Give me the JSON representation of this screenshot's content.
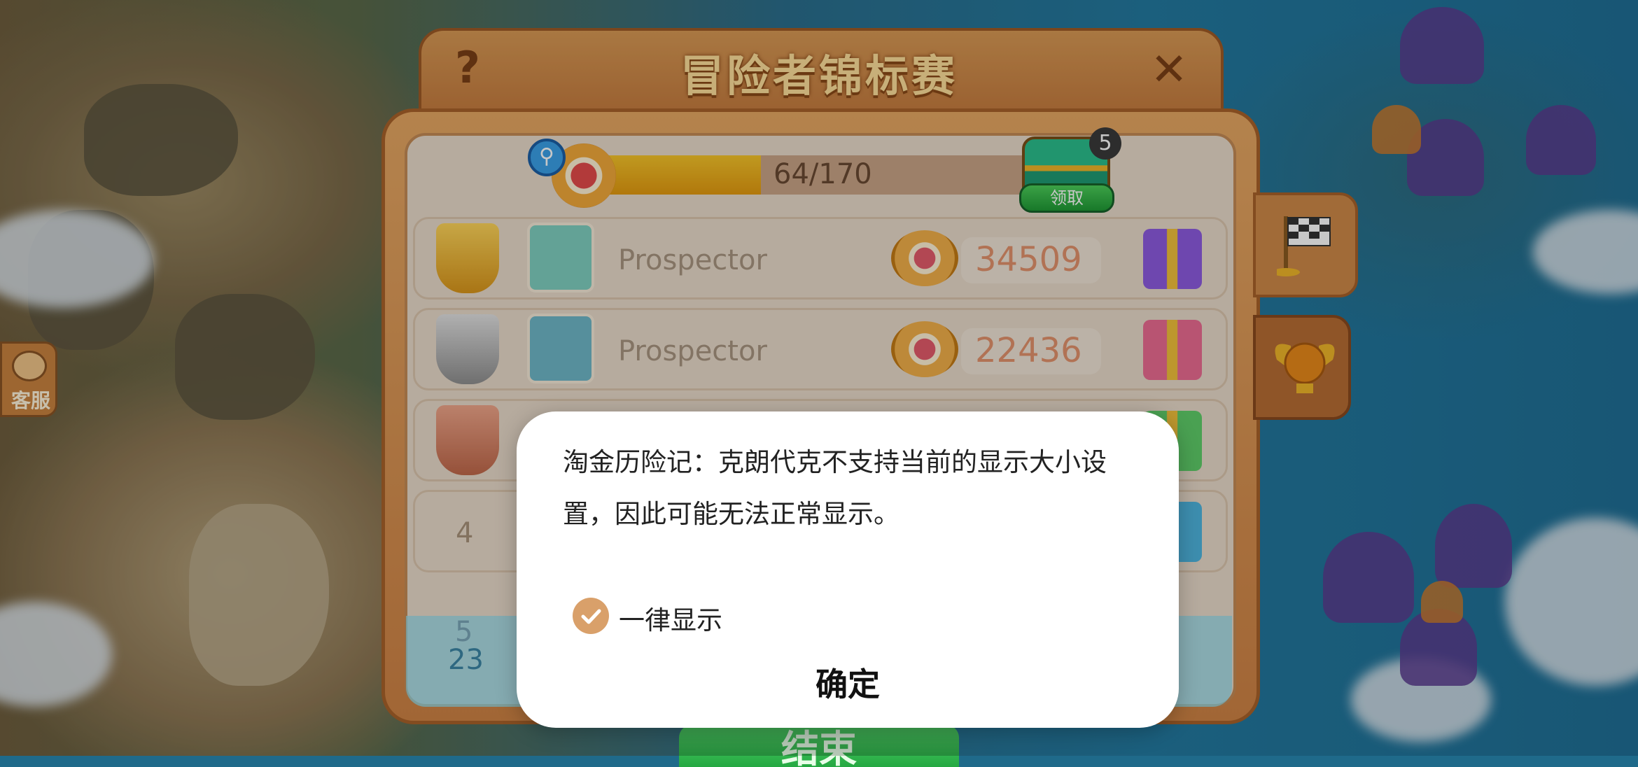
{
  "support": {
    "label": "客服"
  },
  "panel": {
    "title": "冒险者锦标赛",
    "progress": {
      "current": 64,
      "max": 170,
      "text": "64/170",
      "fraction": 0.376
    },
    "chest": {
      "count": "5",
      "claim_label": "领取"
    },
    "rows": [
      {
        "rank": "1",
        "name": "Prospector",
        "score": "34509"
      },
      {
        "rank": "2",
        "name": "Prospector",
        "score": "22436"
      },
      {
        "rank": "3"
      },
      {
        "rank": "4"
      },
      {
        "rank": "5",
        "sub": "23"
      }
    ],
    "end_label": "结束"
  },
  "dialog": {
    "message": "淘金历险记：克朗代克不支持当前的显示大小设置，因此可能无法正常显示。",
    "checkbox_label": "一律显示",
    "checkbox_checked": true,
    "ok_label": "确定",
    "accent_color": "#d9a06a"
  },
  "icons": [
    "help-icon",
    "close-icon",
    "search-icon",
    "star-badge-icon",
    "chest-icon",
    "trophy-gold-icon",
    "trophy-silver-icon",
    "trophy-bronze-icon",
    "gift-icon",
    "flag-icon",
    "globe-icon",
    "check-icon",
    "support-icon"
  ]
}
